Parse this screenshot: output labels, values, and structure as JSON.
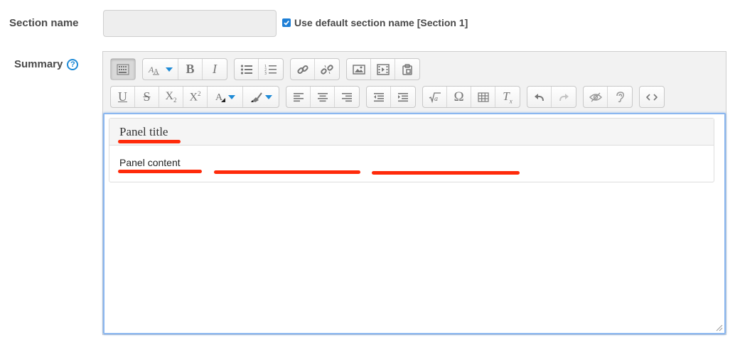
{
  "form": {
    "section_name_label": "Section name",
    "section_name_value": "",
    "use_default_label": "Use default section name [Section 1]",
    "use_default_checked": true,
    "summary_label": "Summary",
    "help_glyph": "?"
  },
  "toolbar": {
    "row1": [
      [
        "toolbar-toggle-icon"
      ],
      [
        "font-style-icon",
        "bold-icon",
        "italic-icon"
      ],
      [
        "unordered-list-icon",
        "ordered-list-icon"
      ],
      [
        "link-icon",
        "unlink-icon"
      ],
      [
        "image-icon",
        "media-icon",
        "manage-files-icon"
      ]
    ],
    "row2": [
      [
        "underline-icon",
        "strikethrough-icon",
        "subscript-icon",
        "superscript-icon",
        "font-color-icon",
        "background-color-icon"
      ],
      [
        "align-left-icon",
        "align-center-icon",
        "align-right-icon"
      ],
      [
        "outdent-icon",
        "indent-icon"
      ],
      [
        "equation-icon",
        "special-character-icon",
        "table-icon",
        "clear-formatting-icon"
      ],
      [
        "undo-icon",
        "redo-icon"
      ],
      [
        "accessibility-checker-icon",
        "screen-reader-helper-icon"
      ],
      [
        "html-icon"
      ]
    ]
  },
  "editor": {
    "panel_title": "Panel title",
    "panel_content": "Panel content"
  },
  "colors": {
    "accent": "#1e8ad6",
    "annotation": "#ff2a0a",
    "focus_border": "#8ab7f0"
  }
}
